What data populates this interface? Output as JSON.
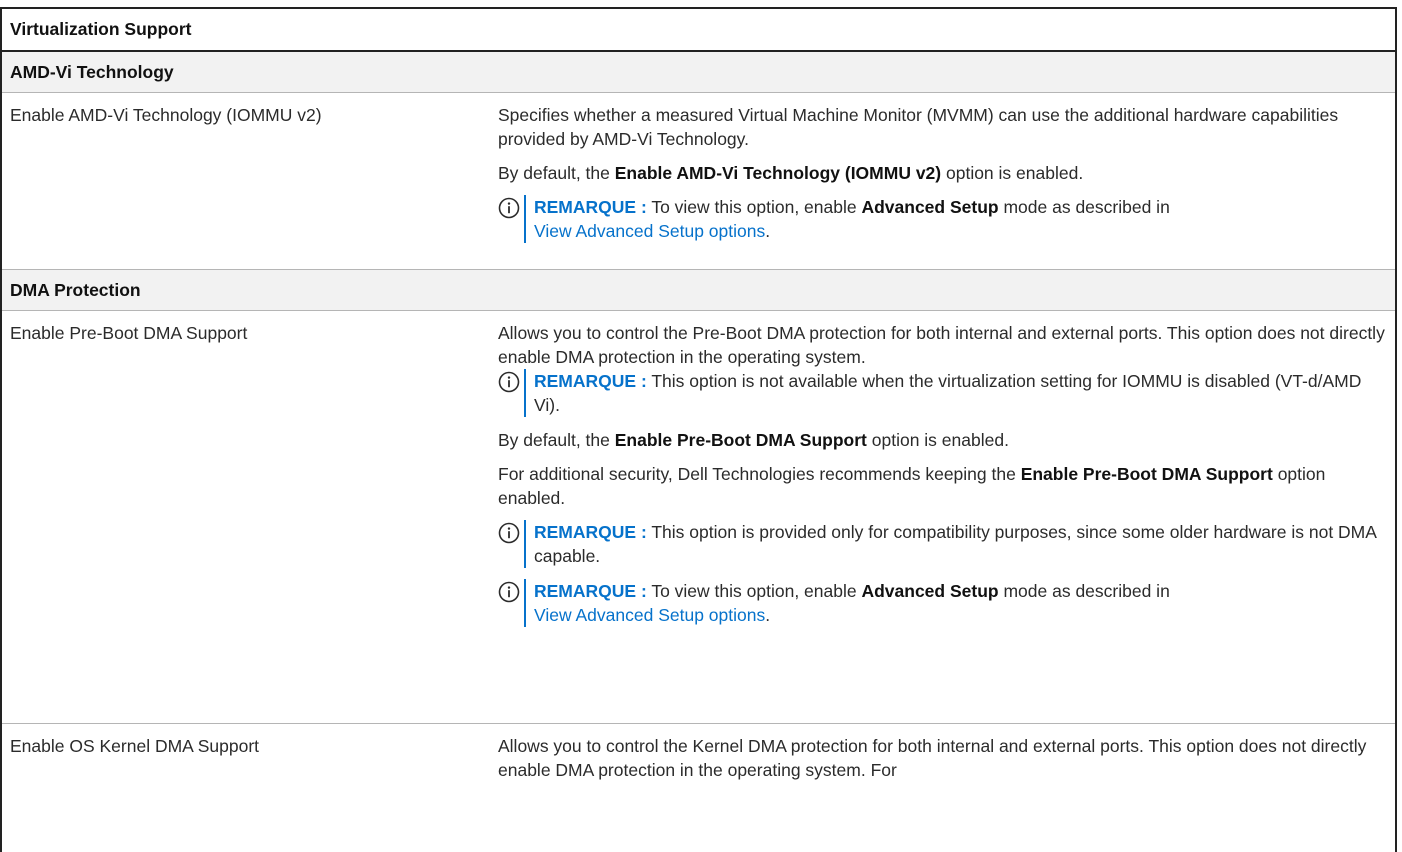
{
  "table": {
    "title": "Virtualization Support"
  },
  "sections": {
    "amd": {
      "heading": "AMD-Vi Technology",
      "setting": {
        "name": "Enable AMD-Vi Technology (IOMMU v2)",
        "desc": "Specifies whether a measured Virtual Machine Monitor (MVMM) can use the additional hardware capabilities provided by AMD-Vi Technology.",
        "default_pre": "By default, the ",
        "default_bold": "Enable AMD-Vi Technology (IOMMU v2)",
        "default_post": " option is enabled.",
        "note": {
          "label": "REMARQUE :",
          "text_pre": " To view this option, enable ",
          "text_bold": "Advanced Setup",
          "text_post": " mode as described in ",
          "link": "View Advanced Setup options",
          "end": "."
        }
      }
    },
    "dma": {
      "heading": "DMA Protection",
      "preboot": {
        "name": "Enable Pre-Boot DMA Support",
        "desc": "Allows you to control the Pre-Boot DMA protection for both internal and external ports. This option does not directly enable DMA protection in the operating system.",
        "note1": {
          "label": "REMARQUE :",
          "text": " This option is not available when the virtualization setting for IOMMU is disabled (VT-d/AMD Vi)."
        },
        "default_pre": "By default, the ",
        "default_bold": "Enable Pre-Boot DMA Support",
        "default_post": " option is enabled.",
        "security_pre": "For additional security, Dell Technologies recommends keeping the ",
        "security_bold": "Enable Pre-Boot DMA Support",
        "security_post": " option enabled.",
        "note2": {
          "label": "REMARQUE :",
          "text": " This option is provided only for compatibility purposes, since some older hardware is not DMA capable."
        },
        "note3": {
          "label": "REMARQUE :",
          "text_pre": " To view this option, enable ",
          "text_bold": "Advanced Setup",
          "text_post": " mode as described in ",
          "link": "View Advanced Setup options",
          "end": "."
        }
      },
      "oskernel": {
        "name": "Enable OS Kernel DMA Support",
        "desc": "Allows you to control the Kernel DMA protection for both internal and external ports. This option does not directly enable DMA protection in the operating system. For"
      }
    }
  },
  "icons": {
    "note": "info-circle-icon"
  },
  "colors": {
    "accent": "#0672cb",
    "section_bg": "#f2f2f2",
    "border": "#222222"
  }
}
